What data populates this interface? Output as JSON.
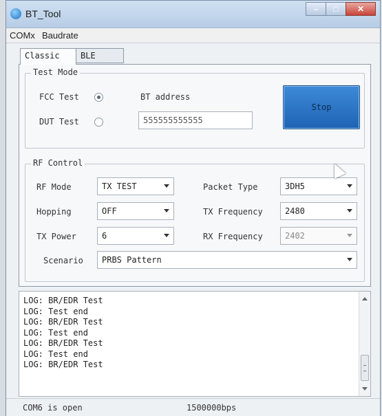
{
  "window": {
    "title": "BT_Tool"
  },
  "menu": {
    "items": [
      "COMx",
      "Baudrate"
    ]
  },
  "tabs": [
    {
      "label": "Classic",
      "active": true
    },
    {
      "label": "BLE",
      "active": false
    }
  ],
  "test_mode": {
    "label": "Test Mode",
    "fcc_label": "FCC Test",
    "fcc_checked": true,
    "dut_label": "DUT Test",
    "dut_checked": false,
    "bt_address_label": "BT address",
    "bt_address_value": "555555555555",
    "stop_label": "Stop"
  },
  "rf_control": {
    "label": "RF Control",
    "rf_mode_label": "RF Mode",
    "rf_mode_value": "TX TEST",
    "packet_type_label": "Packet Type",
    "packet_type_value": "3DH5",
    "hopping_label": "Hopping",
    "hopping_value": "OFF",
    "tx_frequency_label": "TX Frequency",
    "tx_frequency_value": "2480",
    "tx_power_label": "TX Power",
    "tx_power_value": "6",
    "rx_frequency_label": "RX Frequency",
    "rx_frequency_value": "2402",
    "scenario_label": "Scenario",
    "scenario_value": "PRBS Pattern"
  },
  "log": {
    "lines": [
      "LOG: BR/EDR Test",
      "LOG: Test end",
      "LOG: BR/EDR Test",
      "LOG: Test end",
      "LOG: BR/EDR Test",
      "LOG: Test end",
      "LOG: BR/EDR Test"
    ]
  },
  "status": {
    "port": "COM6 is open",
    "baud": "1500000bps"
  },
  "colors": {
    "stop_button": "#2a74c8",
    "title_bar": "#c4d7ec",
    "close_button": "#c8453a"
  }
}
